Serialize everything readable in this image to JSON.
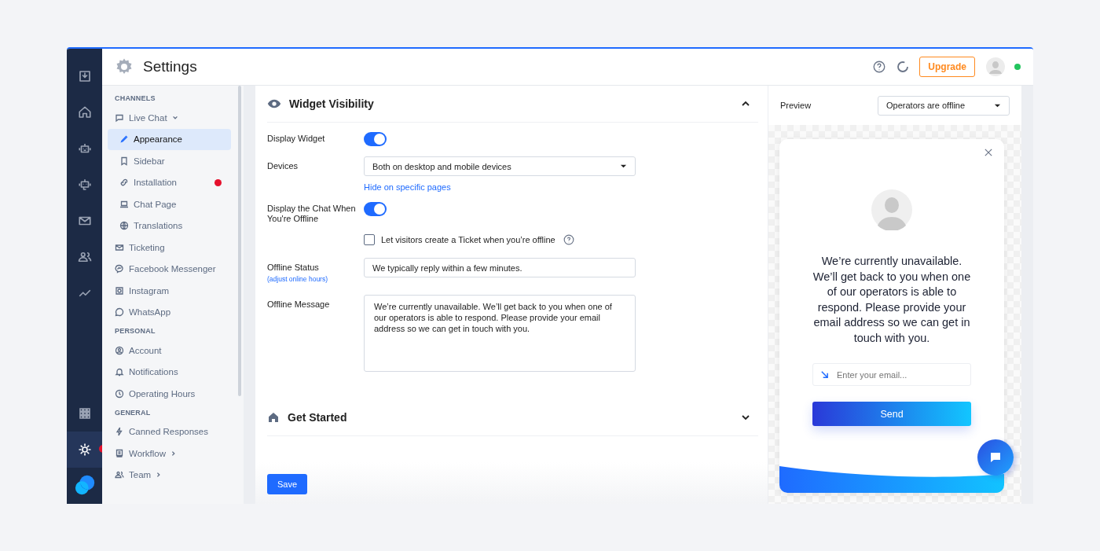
{
  "header": {
    "title": "Settings",
    "upgrade": "Upgrade",
    "online": true
  },
  "rail": [
    {
      "selected": false,
      "badge": false
    },
    {
      "selected": false,
      "badge": false
    },
    {
      "selected": false,
      "badge": false
    },
    {
      "selected": false,
      "badge": false
    },
    {
      "selected": false,
      "badge": false
    },
    {
      "selected": false,
      "badge": false
    },
    {
      "selected": false,
      "badge": false
    }
  ],
  "rail_bottom": [
    {
      "selected": false,
      "badge": false
    },
    {
      "selected": true,
      "badge": true
    }
  ],
  "sidebar": [
    {
      "heading": "CHANNELS",
      "items": [
        {
          "label": "Live Chat",
          "selected": false,
          "badge": false,
          "expanded": true,
          "children": [
            {
              "label": "Appearance",
              "selected": true,
              "badge": false
            },
            {
              "label": "Sidebar",
              "selected": false,
              "badge": false
            },
            {
              "label": "Installation",
              "selected": false,
              "badge": true
            },
            {
              "label": "Chat Page",
              "selected": false,
              "badge": false
            },
            {
              "label": "Translations",
              "selected": false,
              "badge": false
            }
          ]
        },
        {
          "label": "Ticketing",
          "selected": false,
          "badge": false
        },
        {
          "label": "Facebook Messenger",
          "selected": false,
          "badge": false
        },
        {
          "label": "Instagram",
          "selected": false,
          "badge": false
        },
        {
          "label": "WhatsApp",
          "selected": false,
          "badge": false
        }
      ]
    },
    {
      "heading": "PERSONAL",
      "items": [
        {
          "label": "Account",
          "selected": false,
          "badge": false
        },
        {
          "label": "Notifications",
          "selected": false,
          "badge": false
        },
        {
          "label": "Operating Hours",
          "selected": false,
          "badge": false
        }
      ]
    },
    {
      "heading": "GENERAL",
      "items": [
        {
          "label": "Canned Responses",
          "selected": false,
          "badge": false
        },
        {
          "label": "Workflow",
          "selected": false,
          "badge": false,
          "expanded": false
        },
        {
          "label": "Team",
          "selected": false,
          "badge": false,
          "expanded": false
        }
      ]
    }
  ],
  "section": {
    "title": "Widget Visibility",
    "expanded": true,
    "rows": [
      {
        "kind": "toggle",
        "label": "Display Widget",
        "on": true
      },
      {
        "kind": "select",
        "label": "Devices",
        "value": "Both on desktop and mobile devices",
        "link": "Hide on specific pages"
      },
      {
        "kind": "toggle",
        "label": "Display the Chat When You're Offline",
        "on": true
      },
      {
        "kind": "checkbox",
        "label": "Let visitors create a Ticket when you’re offline",
        "checked": false
      },
      {
        "kind": "text",
        "label": "Offline Status",
        "sublink": "(adjust online hours)",
        "value": "We typically reply within a few minutes."
      },
      {
        "kind": "textarea",
        "label": "Offline Message",
        "value": "We’re currently unavailable. We’ll get back to you when one of our operators is able to respond. Please provide your email address so we can get in touch with you."
      }
    ]
  },
  "section2": {
    "title": "Get Started",
    "expanded": false
  },
  "save": "Save",
  "preview": {
    "label": "Preview",
    "select": "Operators are offline",
    "message": "We’re currently unavailable. We’ll get back to you when one of our operators is able to respond. Please provide your email address so we can get in touch with you.",
    "email_placeholder": "Enter your email...",
    "send": "Send"
  }
}
